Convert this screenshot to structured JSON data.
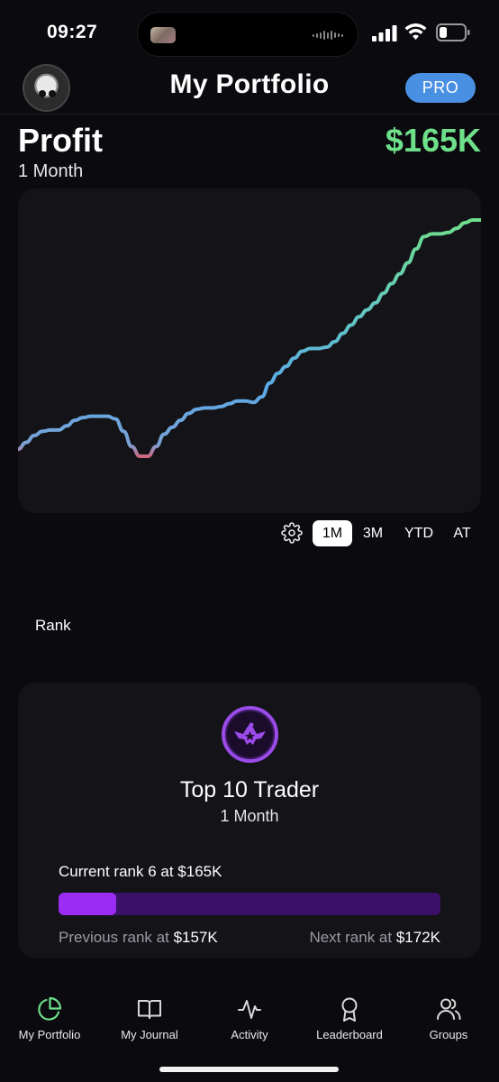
{
  "status_bar": {
    "time": "09:27"
  },
  "header": {
    "title": "My Portfolio",
    "badge": "PRO"
  },
  "profit": {
    "label": "Profit",
    "value": "$165K",
    "period": "1 Month",
    "value_color": "#6fe08a"
  },
  "chart_data": {
    "type": "line",
    "title": "",
    "xlabel": "",
    "ylabel": "",
    "grid": false,
    "line_colors": [
      "#5aa9e6",
      "#e05d6f",
      "#6fe08a"
    ],
    "x": [
      0,
      1,
      2,
      3,
      4,
      5,
      6,
      7,
      8,
      9,
      10,
      11,
      12,
      13,
      14,
      15,
      16,
      17,
      18,
      19,
      20,
      21,
      22,
      23,
      24,
      25,
      26,
      27,
      28,
      29,
      30,
      31,
      32,
      33,
      34,
      35,
      36,
      37,
      38,
      39,
      40,
      41,
      42,
      43,
      44,
      45,
      46,
      47,
      48,
      49,
      50,
      51,
      52,
      53,
      54,
      55,
      56,
      57
    ],
    "values": [
      0,
      5,
      10,
      13,
      14,
      14,
      17,
      21,
      23,
      24,
      24,
      24,
      22,
      13,
      2,
      -5,
      -5,
      2,
      11,
      16,
      21,
      26,
      29,
      30,
      30,
      31,
      33,
      35,
      35,
      34,
      38,
      48,
      55,
      60,
      66,
      71,
      73,
      73,
      74,
      78,
      84,
      90,
      96,
      101,
      106,
      113,
      120,
      127,
      135,
      145,
      154,
      156,
      156,
      157,
      160,
      164,
      166,
      166
    ],
    "labels": {
      "start": "",
      "end": ""
    }
  },
  "timeframes": {
    "options": [
      "1M",
      "3M",
      "YTD",
      "AT"
    ],
    "selected": "1M"
  },
  "rank_section": {
    "heading": "Rank",
    "title": "Top 10 Trader",
    "period": "1 Month",
    "current": "Current rank 6 at $165K",
    "progress": 0.15,
    "previous_label": "Previous rank at ",
    "previous_value": "$157K",
    "next_label": "Next rank at ",
    "next_value": "$172K",
    "accent": "#9a2cf4"
  },
  "tab_bar": {
    "items": [
      {
        "label": "My Portfolio",
        "icon": "pie-chart-icon",
        "active": true
      },
      {
        "label": "My Journal",
        "icon": "book-icon",
        "active": false
      },
      {
        "label": "Activity",
        "icon": "activity-icon",
        "active": false
      },
      {
        "label": "Leaderboard",
        "icon": "award-icon",
        "active": false
      },
      {
        "label": "Groups",
        "icon": "users-icon",
        "active": false
      }
    ],
    "active_color": "#6fe08a"
  }
}
